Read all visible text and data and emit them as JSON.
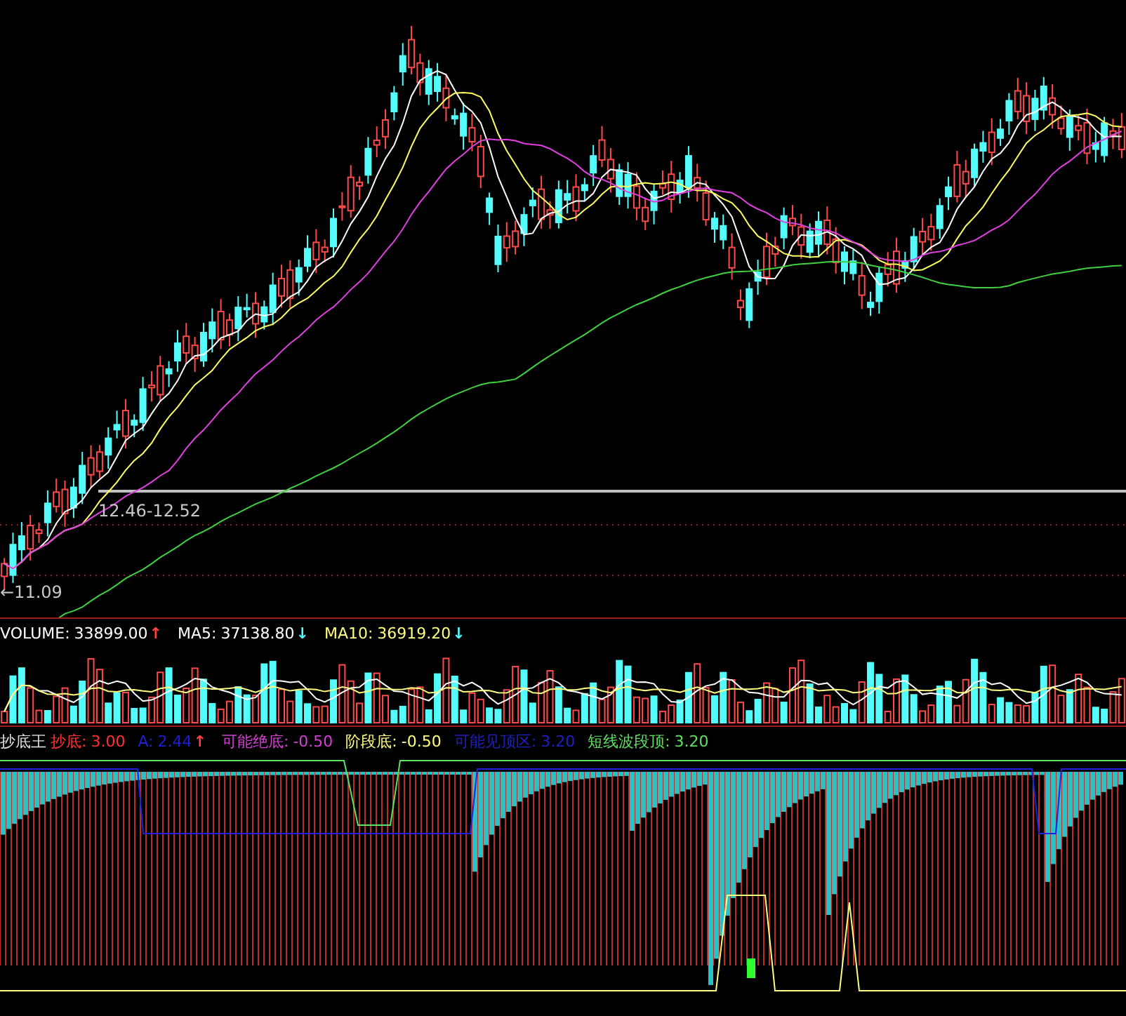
{
  "price_panel": {
    "labels": [
      {
        "text": "12.46-12.52",
        "kind": "range"
      },
      {
        "text": "←11.09",
        "kind": "low"
      }
    ]
  },
  "volume_panel": {
    "legend": [
      {
        "label": "VOLUME:",
        "value": "33899.00",
        "arrow": "↑",
        "rising": true,
        "color": "#ffffff"
      },
      {
        "label": "MA5:",
        "value": "37138.80",
        "arrow": "↓",
        "rising": false,
        "color": "#ffffff"
      },
      {
        "label": "MA10:",
        "value": "36919.20",
        "arrow": "↓",
        "rising": false,
        "color": "#ffff80"
      }
    ]
  },
  "indicator_panel": {
    "title": "抄底王",
    "legend": [
      {
        "label": "抄底:",
        "value": "3.00",
        "color": "#ff3030"
      },
      {
        "label": "A:",
        "value": "2.44",
        "arrow": "↑",
        "rising": true,
        "color": "#2020d0"
      },
      {
        "label": "可能绝底:",
        "value": "-0.50",
        "color": "#d040d0"
      },
      {
        "label": "阶段底:",
        "value": "-0.50",
        "color": "#ffff80"
      },
      {
        "label": "可能见顶区:",
        "value": "3.20",
        "color": "#2020c0"
      },
      {
        "label": "短线波段顶:",
        "value": "3.20",
        "color": "#60e060"
      }
    ]
  }
}
